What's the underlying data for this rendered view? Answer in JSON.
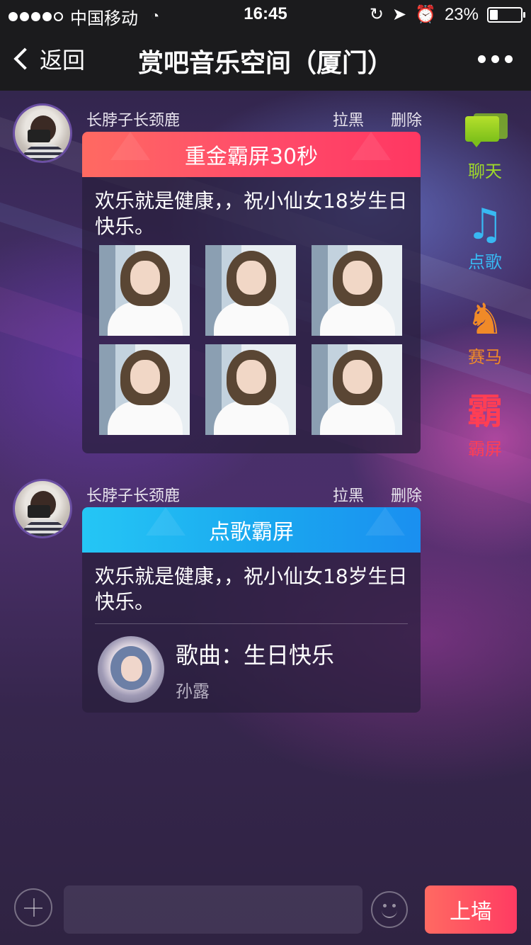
{
  "status_bar": {
    "carrier": "中国移动",
    "time": "16:45",
    "battery": "23%",
    "battery_level": 0.23,
    "signal_bars_filled": 4,
    "signal_bars_total": 5
  },
  "nav": {
    "back_label": "返回",
    "title": "赏吧音乐空间（厦门）"
  },
  "messages": [
    {
      "user": "长脖子长颈鹿",
      "block_label": "拉黑",
      "delete_label": "删除",
      "card_title": "重金霸屏30秒",
      "text": "欢乐就是健康，，祝小仙女18岁生日快乐。",
      "photo_count": 6
    },
    {
      "user": "长脖子长颈鹿",
      "block_label": "拉黑",
      "delete_label": "删除",
      "card_title": "点歌霸屏",
      "text": "欢乐就是健康，，祝小仙女18岁生日快乐。",
      "song_title": "歌曲：生日快乐",
      "song_artist": "孙露"
    }
  ],
  "side_menu": [
    {
      "label": "聊天",
      "icon": "chat-bubbles-icon",
      "color": "#9fd92a"
    },
    {
      "label": "点歌",
      "icon": "music-note-icon",
      "color": "#38b8f2"
    },
    {
      "label": "赛马",
      "icon": "horse-icon",
      "color": "#f08a28"
    },
    {
      "label": "霸屏",
      "icon": "ba-character-icon",
      "color": "#ff3e54"
    }
  ],
  "bottom_bar": {
    "input_value": "",
    "send_label": "上墙"
  },
  "colors": {
    "red_gradient_start": "#ff6a62",
    "red_gradient_end": "#ff3762",
    "blue_gradient_start": "#25c6f5",
    "blue_gradient_end": "#1a8ff0"
  }
}
